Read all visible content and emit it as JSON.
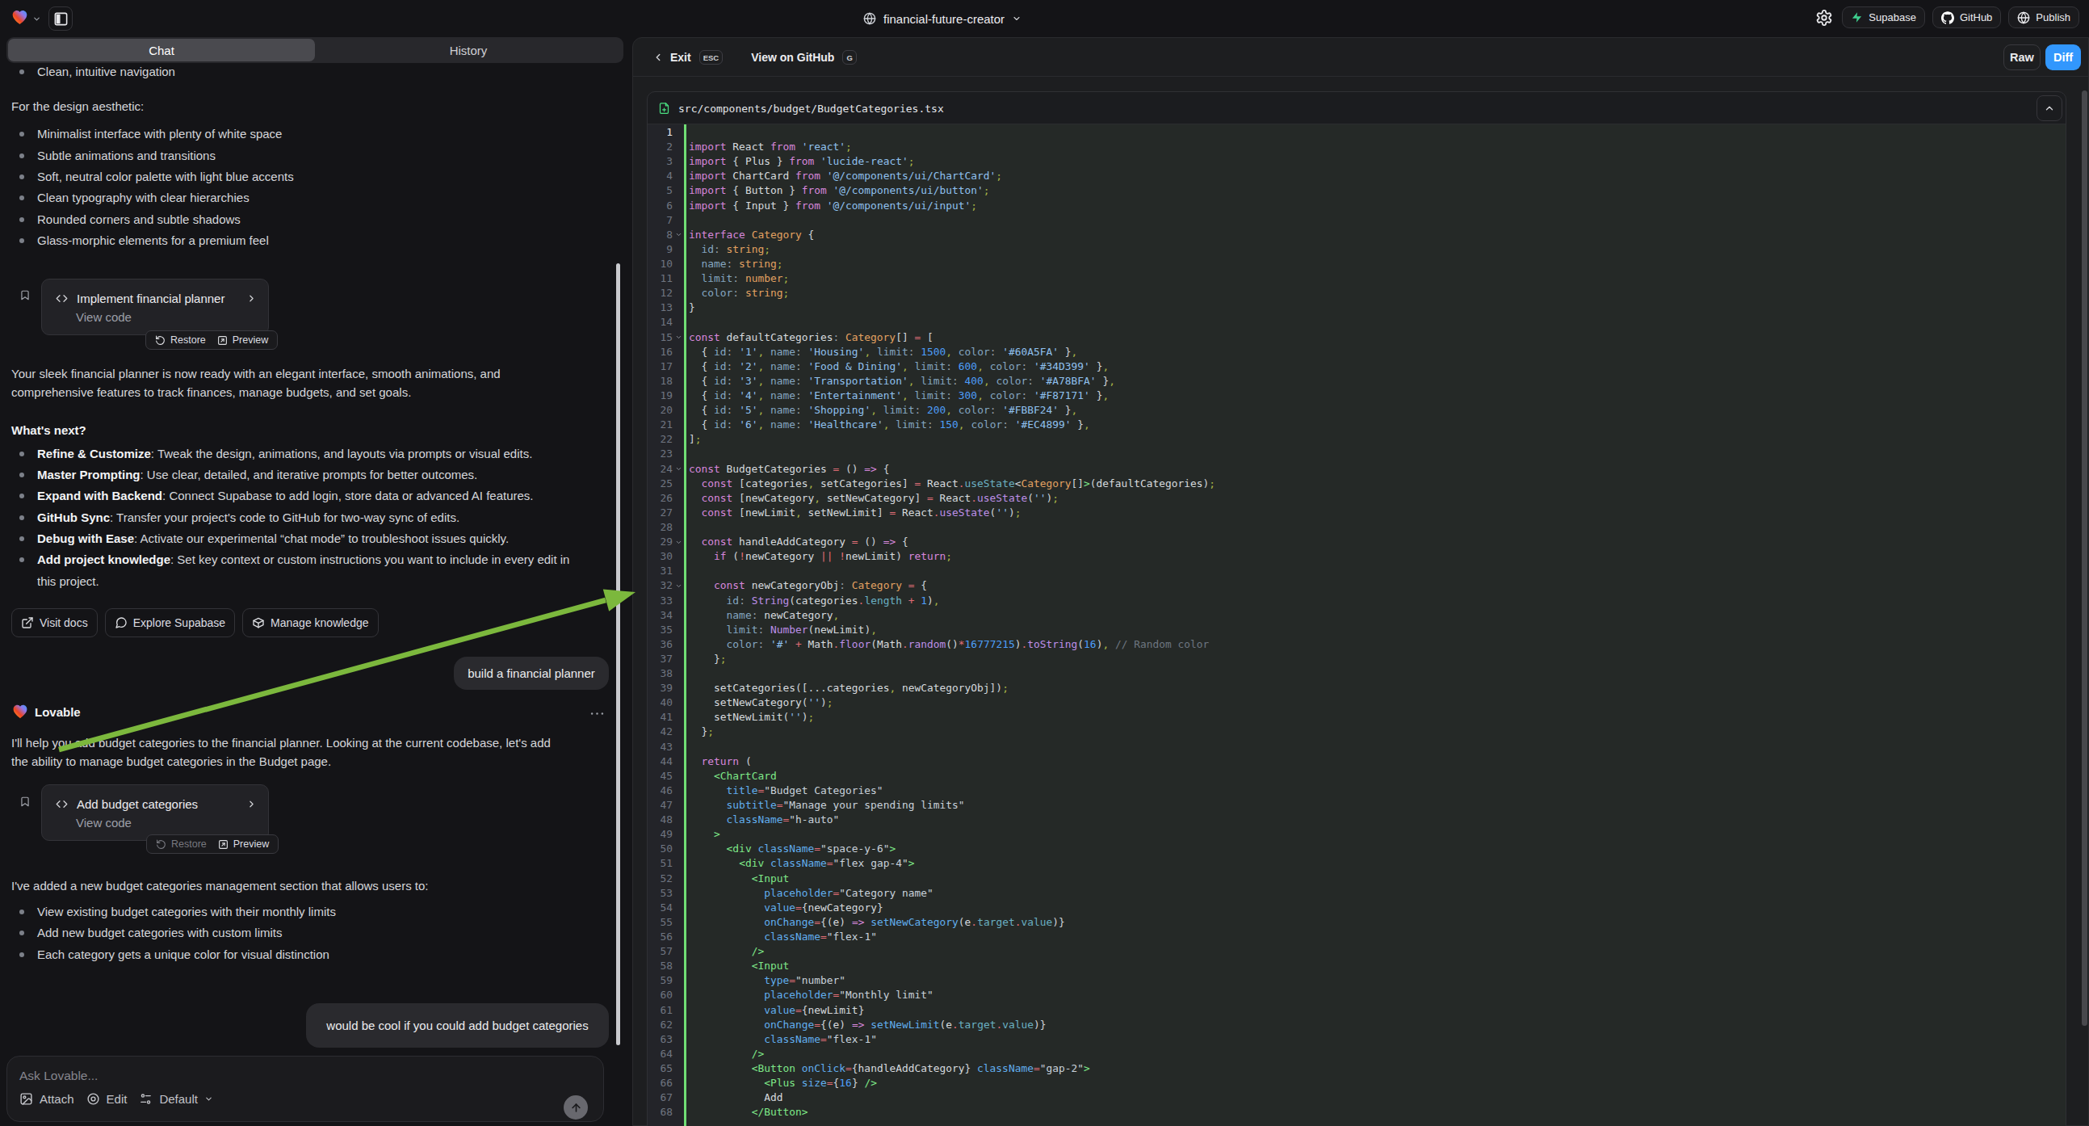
{
  "topbar": {
    "project_name": "financial-future-creator",
    "supabase_label": "Supabase",
    "github_label": "GitHub",
    "publish_label": "Publish"
  },
  "chat": {
    "tab_chat": "Chat",
    "tab_history": "History",
    "scrolled_bullet": "Clean, intuitive navigation",
    "design_intro": "For the design aesthetic:",
    "design_bullets": [
      "Minimalist interface with plenty of white space",
      "Subtle animations and transitions",
      "Soft, neutral color palette with light blue accents",
      "Clean typography with clear hierarchies",
      "Rounded corners and subtle shadows",
      "Glass-morphic elements for a premium feel"
    ],
    "card1": {
      "title": "Implement financial planner",
      "subtitle": "View code",
      "restore": "Restore",
      "preview": "Preview"
    },
    "ready_line1": "Your sleek financial planner is now ready with an elegant interface, smooth animations, and",
    "ready_line2": "comprehensive features to track finances, manage budgets, and set goals.",
    "whats_next": "What's next?",
    "next_bullets": [
      {
        "bold": "Refine & Customize",
        "rest": ": Tweak the design, animations, and layouts via prompts or visual edits."
      },
      {
        "bold": "Master Prompting",
        "rest": ": Use clear, detailed, and iterative prompts for better outcomes."
      },
      {
        "bold": "Expand with Backend",
        "rest": ": Connect Supabase to add login, store data or advanced AI features."
      },
      {
        "bold": "GitHub Sync",
        "rest": ": Transfer your project's code to GitHub for two-way sync of edits."
      },
      {
        "bold": "Debug with Ease",
        "rest": ": Activate our experimental “chat mode” to troubleshoot issues quickly."
      },
      {
        "bold": "Add project knowledge",
        "rest": ": Set key context or custom instructions you want to include in every edit in this project."
      }
    ],
    "visit_docs": "Visit docs",
    "explore_supabase": "Explore Supabase",
    "manage_knowledge": "Manage knowledge",
    "user_message_1": "build a financial planner",
    "assistant_name": "Lovable",
    "assistant_line1": "I'll help you add budget categories to the financial planner. Looking at the current codebase, let's add",
    "assistant_line2": "the ability to manage budget categories in the Budget page.",
    "card2": {
      "title": "Add budget categories",
      "subtitle": "View code",
      "restore": "Restore",
      "preview": "Preview"
    },
    "added_intro": "I've added a new budget categories management section that allows users to:",
    "added_bullets": [
      "View existing budget categories with their monthly limits",
      "Add new budget categories with custom limits",
      "Each category gets a unique color for visual distinction"
    ],
    "user_message_2": "would be cool if you could add budget categories",
    "ask_placeholder": "Ask Lovable...",
    "attach_label": "Attach",
    "edit_label": "Edit",
    "mode_label": "Default"
  },
  "code_panel": {
    "exit_label": "Exit",
    "esc_key": "ESC",
    "view_on_github": "View on GitHub",
    "g_key": "G",
    "raw_label": "Raw",
    "diff_label": "Diff",
    "diff_color": "#3297fd",
    "diff_added_color": "#70dd74",
    "file_path": "src/components/budget/BudgetCategories.tsx",
    "cursor_line": 1,
    "fold_lines": [
      8,
      15,
      24,
      29,
      32
    ],
    "code_lines": [
      "",
      "import React from 'react';",
      "import { Plus } from 'lucide-react';",
      "import ChartCard from '@/components/ui/ChartCard';",
      "import { Button } from '@/components/ui/button';",
      "import { Input } from '@/components/ui/input';",
      "",
      "interface Category {",
      "  id: string;",
      "  name: string;",
      "  limit: number;",
      "  color: string;",
      "}",
      "",
      "const defaultCategories: Category[] = [",
      "  { id: '1', name: 'Housing', limit: 1500, color: '#60A5FA' },",
      "  { id: '2', name: 'Food & Dining', limit: 600, color: '#34D399' },",
      "  { id: '3', name: 'Transportation', limit: 400, color: '#A78BFA' },",
      "  { id: '4', name: 'Entertainment', limit: 300, color: '#F87171' },",
      "  { id: '5', name: 'Shopping', limit: 200, color: '#FBBF24' },",
      "  { id: '6', name: 'Healthcare', limit: 150, color: '#EC4899' },",
      "];",
      "",
      "const BudgetCategories = () => {",
      "  const [categories, setCategories] = React.useState<Category[]>(defaultCategories);",
      "  const [newCategory, setNewCategory] = React.useState('');",
      "  const [newLimit, setNewLimit] = React.useState('');",
      "",
      "  const handleAddCategory = () => {",
      "    if (!newCategory || !newLimit) return;",
      "",
      "    const newCategoryObj: Category = {",
      "      id: String(categories.length + 1),",
      "      name: newCategory,",
      "      limit: Number(newLimit),",
      "      color: '#' + Math.floor(Math.random()*16777215).toString(16), // Random color",
      "    };",
      "",
      "    setCategories([...categories, newCategoryObj]);",
      "    setNewCategory('');",
      "    setNewLimit('');",
      "  };",
      "",
      "  return (",
      "    <ChartCard",
      "      title=\"Budget Categories\"",
      "      subtitle=\"Manage your spending limits\"",
      "      className=\"h-auto\"",
      "    >",
      "      <div className=\"space-y-6\">",
      "        <div className=\"flex gap-4\">",
      "          <Input",
      "            placeholder=\"Category name\"",
      "            value={newCategory}",
      "            onChange={(e) => setNewCategory(e.target.value)}",
      "            className=\"flex-1\"",
      "          />",
      "          <Input",
      "            type=\"number\"",
      "            placeholder=\"Monthly limit\"",
      "            value={newLimit}",
      "            onChange={(e) => setNewLimit(e.target.value)}",
      "            className=\"flex-1\"",
      "          />",
      "          <Button onClick={handleAddCategory} className=\"gap-2\">",
      "            <Plus size={16} />",
      "            Add",
      "          </Button>"
    ]
  }
}
